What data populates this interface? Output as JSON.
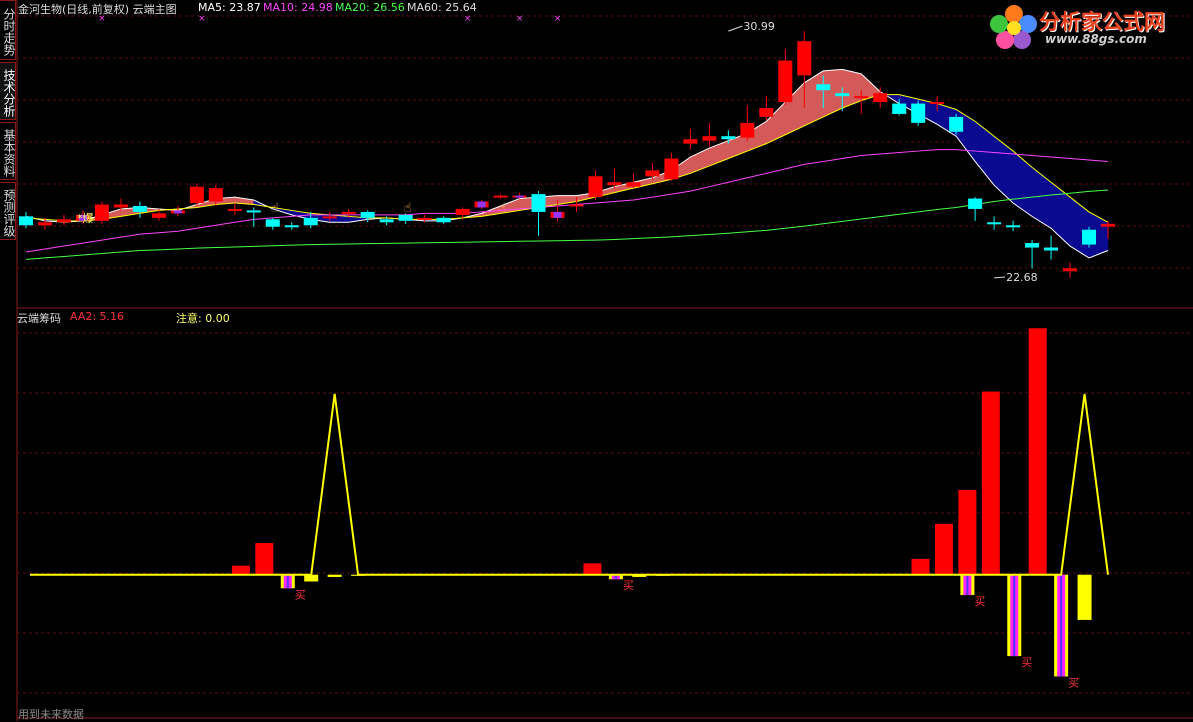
{
  "side_tabs": [
    {
      "label": "分时走势",
      "active": false
    },
    {
      "label": "技术分析",
      "active": true
    },
    {
      "label": "基本资料",
      "active": false
    },
    {
      "label": "预测评级",
      "active": false
    }
  ],
  "main_header": {
    "title": "金河生物(日线,前复权) 云端主图",
    "ma5": "MA5: 23.87",
    "ma10": "MA10: 24.98",
    "ma20": "MA20: 26.56",
    "ma60": "MA60: 25.64"
  },
  "sub_header": {
    "title": "云端筹码",
    "aa2": "AA2: 5.16",
    "note": "注意: 0.00"
  },
  "logo": {
    "title": "分析家公式网",
    "url": "www.88gs.com"
  },
  "footer": "用到未来数据",
  "annotations": {
    "high": "30.99",
    "low": "22.68",
    "burst": "爆",
    "buy": "买"
  },
  "colors": {
    "up": "#ff0000",
    "down": "#00ffff",
    "special": "#9933ff",
    "ma5": "#ffffff",
    "ma10": "#ffff00",
    "ma20": "#ff44ff",
    "ma60": "#44ff44",
    "cloud_up": "#d45a5a",
    "cloud_down": "#0a0a90",
    "zero_line": "#ffff00"
  },
  "chart_data": [
    {
      "type": "candlestick",
      "title": "金河生物(日线,前复权) 云端主图",
      "ylim": [
        22.0,
        31.5
      ],
      "candles": [
        [
          24.75,
          24.45,
          24.9,
          24.35
        ],
        [
          24.45,
          24.55,
          24.7,
          24.3
        ],
        [
          24.55,
          24.65,
          24.8,
          24.45
        ],
        [
          24.6,
          24.8,
          24.95,
          24.5
        ],
        [
          24.6,
          25.15,
          25.25,
          24.5
        ],
        [
          25.05,
          25.15,
          25.35,
          24.95
        ],
        [
          25.1,
          24.9,
          25.25,
          24.7
        ],
        [
          24.7,
          24.85,
          25.0,
          24.6
        ],
        [
          24.85,
          24.95,
          25.1,
          24.75
        ],
        [
          25.2,
          25.75,
          25.85,
          25.1
        ],
        [
          25.25,
          25.7,
          25.8,
          25.1
        ],
        [
          25.0,
          25.0,
          25.2,
          24.8
        ],
        [
          24.95,
          24.9,
          25.05,
          24.4
        ],
        [
          24.65,
          24.4,
          24.7,
          24.3
        ],
        [
          24.45,
          24.4,
          24.55,
          24.3
        ],
        [
          24.7,
          24.45,
          24.9,
          24.35
        ],
        [
          24.75,
          24.75,
          24.9,
          24.6
        ],
        [
          24.85,
          24.9,
          25.0,
          24.7
        ],
        [
          24.9,
          24.7,
          24.95,
          24.55
        ],
        [
          24.65,
          24.55,
          24.75,
          24.45
        ],
        [
          24.8,
          24.6,
          24.85,
          24.5
        ],
        [
          24.7,
          24.7,
          24.8,
          24.55
        ],
        [
          24.7,
          24.55,
          24.75,
          24.5
        ],
        [
          24.8,
          25.0,
          25.05,
          24.65
        ],
        [
          25.05,
          25.25,
          25.3,
          25.0
        ],
        [
          25.4,
          25.45,
          25.5,
          25.35
        ],
        [
          25.4,
          25.45,
          25.55,
          25.35
        ],
        [
          25.5,
          24.9,
          25.6,
          24.1
        ],
        [
          24.7,
          24.9,
          25.3,
          24.6
        ],
        [
          25.1,
          25.15,
          25.4,
          24.9
        ],
        [
          25.4,
          26.1,
          26.3,
          25.3
        ],
        [
          25.8,
          25.9,
          26.35,
          25.7
        ],
        [
          25.75,
          25.9,
          26.2,
          25.7
        ],
        [
          26.1,
          26.3,
          26.55,
          26.0
        ],
        [
          26.0,
          26.7,
          26.9,
          25.95
        ],
        [
          27.2,
          27.35,
          27.7,
          27.0
        ],
        [
          27.3,
          27.45,
          27.9,
          27.1
        ],
        [
          27.45,
          27.35,
          27.65,
          27.2
        ],
        [
          27.4,
          27.9,
          28.5,
          27.3
        ],
        [
          28.1,
          28.4,
          28.8,
          28.0
        ],
        [
          28.6,
          30.0,
          30.4,
          28.5
        ],
        [
          29.5,
          30.65,
          30.99,
          28.4
        ],
        [
          29.2,
          29.0,
          29.5,
          28.4
        ],
        [
          28.9,
          28.8,
          29.1,
          28.3
        ],
        [
          28.8,
          28.8,
          29.0,
          28.2
        ],
        [
          28.6,
          28.9,
          29.1,
          28.4
        ],
        [
          28.55,
          28.2,
          28.7,
          28.15
        ],
        [
          28.55,
          27.9,
          28.65,
          27.8
        ],
        [
          28.6,
          28.6,
          28.8,
          28.3
        ],
        [
          28.1,
          27.6,
          28.2,
          27.5
        ],
        [
          25.35,
          25.0,
          25.4,
          24.6
        ],
        [
          24.55,
          24.5,
          24.75,
          24.3
        ],
        [
          24.45,
          24.4,
          24.6,
          24.25
        ],
        [
          23.85,
          23.7,
          23.95,
          23.0
        ],
        [
          23.7,
          23.6,
          24.1,
          23.3
        ],
        [
          22.9,
          23.0,
          23.2,
          22.68
        ],
        [
          24.3,
          23.8,
          24.4,
          23.7
        ],
        [
          24.4,
          24.5,
          24.6,
          24.0
        ]
      ],
      "special_candles": [
        3,
        8,
        24,
        26,
        28
      ],
      "cloud_down_range": [
        12,
        21
      ],
      "series": [
        {
          "name": "MA5",
          "values": [
            24.75,
            24.6,
            24.55,
            24.6,
            24.8,
            25.0,
            25.05,
            25.0,
            24.95,
            25.15,
            25.35,
            25.4,
            25.3,
            25.0,
            24.8,
            24.65,
            24.55,
            24.55,
            24.65,
            24.7,
            24.65,
            24.6,
            24.6,
            24.7,
            24.85,
            25.1,
            25.35,
            25.4,
            25.45,
            25.45,
            25.55,
            25.75,
            25.9,
            26.05,
            26.3,
            26.75,
            27.05,
            27.3,
            27.55,
            27.95,
            28.6,
            29.25,
            29.65,
            29.7,
            29.55,
            28.95,
            28.55,
            28.2,
            27.85,
            27.45,
            26.6,
            25.8,
            25.2,
            24.75,
            24.35,
            23.75,
            23.35,
            23.6
          ]
        },
        {
          "name": "MA10",
          "values": [
            24.7,
            24.65,
            24.6,
            24.6,
            24.65,
            24.75,
            24.85,
            24.95,
            25.0,
            25.05,
            25.15,
            25.2,
            25.15,
            25.05,
            24.95,
            24.85,
            24.8,
            24.75,
            24.7,
            24.7,
            24.65,
            24.65,
            24.65,
            24.7,
            24.75,
            24.85,
            24.95,
            25.05,
            25.15,
            25.25,
            25.4,
            25.55,
            25.7,
            25.85,
            26.0,
            26.2,
            26.45,
            26.7,
            26.95,
            27.2,
            27.5,
            27.8,
            28.1,
            28.4,
            28.65,
            28.85,
            28.85,
            28.7,
            28.55,
            28.35,
            27.95,
            27.45,
            26.95,
            26.4,
            25.9,
            25.4,
            24.9,
            24.55
          ]
        },
        {
          "name": "MA20",
          "values": [
            23.55,
            23.65,
            23.75,
            23.85,
            23.95,
            24.05,
            24.15,
            24.2,
            24.25,
            24.35,
            24.45,
            24.55,
            24.65,
            24.7,
            24.75,
            24.8,
            24.8,
            24.8,
            24.8,
            24.8,
            24.8,
            24.85,
            24.85,
            24.85,
            24.9,
            24.95,
            25.0,
            25.05,
            25.1,
            25.15,
            25.2,
            25.25,
            25.3,
            25.4,
            25.5,
            25.6,
            25.75,
            25.9,
            26.05,
            26.2,
            26.35,
            26.5,
            26.6,
            26.7,
            26.8,
            26.85,
            26.9,
            26.95,
            27.0,
            27.0,
            26.95,
            26.9,
            26.85,
            26.8,
            26.75,
            26.7,
            26.65,
            26.6
          ]
        },
        {
          "name": "MA60",
          "values": [
            23.3,
            23.35,
            23.4,
            23.45,
            23.5,
            23.55,
            23.6,
            23.62,
            23.65,
            23.68,
            23.7,
            23.72,
            23.74,
            23.76,
            23.78,
            23.8,
            23.81,
            23.82,
            23.83,
            23.84,
            23.85,
            23.86,
            23.87,
            23.88,
            23.89,
            23.9,
            23.91,
            23.92,
            23.93,
            23.94,
            23.95,
            23.97,
            24.0,
            24.03,
            24.06,
            24.1,
            24.14,
            24.18,
            24.23,
            24.28,
            24.35,
            24.42,
            24.5,
            24.58,
            24.66,
            24.74,
            24.82,
            24.9,
            24.98,
            25.05,
            25.15,
            25.25,
            25.33,
            25.4,
            25.47,
            25.53,
            25.59,
            25.64
          ]
        }
      ]
    },
    {
      "type": "bar",
      "title": "云端筹码",
      "ylim": [
        -12.5,
        22.0
      ],
      "positive_values": {
        "9": 0.8,
        "10": 2.8,
        "24": 1.0,
        "38": 1.4,
        "39": 4.5,
        "40": 7.5,
        "41": 16.2,
        "43": 21.8
      },
      "negative_bars": [
        {
          "index": 11,
          "value": -1.2,
          "color": "magenta",
          "buy": true
        },
        {
          "index": 12,
          "value": -0.6,
          "color": "yellow",
          "buy": false
        },
        {
          "index": 13,
          "value": -0.2,
          "color": "yellow",
          "buy": false
        },
        {
          "index": 14,
          "value": -0.1,
          "color": "yellow",
          "buy": false
        },
        {
          "index": 25,
          "value": -0.4,
          "color": "magenta",
          "buy": true
        },
        {
          "index": 26,
          "value": -0.2,
          "color": "yellow",
          "buy": false
        },
        {
          "index": 27,
          "value": -0.1,
          "color": "yellow",
          "buy": false
        },
        {
          "index": 40,
          "value": -1.8,
          "color": "magenta",
          "buy": true
        },
        {
          "index": 42,
          "value": -7.2,
          "color": "magenta",
          "buy": true
        },
        {
          "index": 44,
          "value": -9.0,
          "color": "magenta",
          "buy": true
        },
        {
          "index": 45,
          "value": -4.0,
          "color": "yellow",
          "buy": false
        }
      ],
      "line_values": [
        0,
        0,
        0,
        0,
        0,
        0,
        0,
        0,
        0,
        0,
        0,
        0,
        0,
        0,
        0,
        0,
        0,
        0,
        0,
        0,
        0,
        0,
        0,
        0,
        0,
        0,
        0,
        0,
        0,
        0,
        0,
        0,
        0,
        0,
        0,
        0,
        0,
        0,
        0,
        0,
        0,
        0,
        0,
        0,
        0,
        0,
        0
      ]
    }
  ]
}
